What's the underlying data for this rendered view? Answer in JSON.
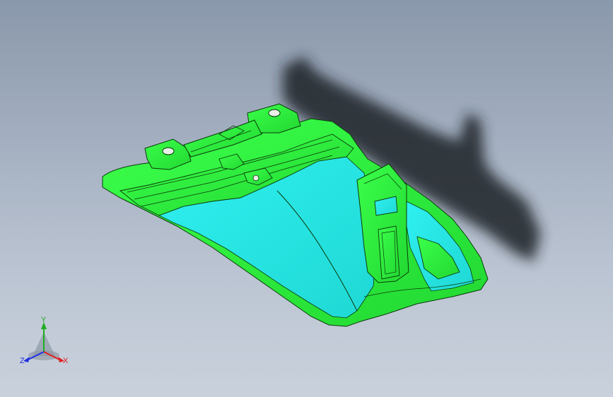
{
  "viewport": {
    "background_top": "#8a98ab",
    "background_bottom": "#c9d1dc"
  },
  "model": {
    "surface_color": "#2bf13c",
    "inner_color": "#25e3e0",
    "edge_color": "#0a3a0a",
    "shadow_color": "#1e2226"
  },
  "triad": {
    "y_label": "Y",
    "x_label": "X",
    "z_label": "Z",
    "y_color": "#1fae1f",
    "x_color": "#e02020",
    "z_color": "#2030e0"
  }
}
